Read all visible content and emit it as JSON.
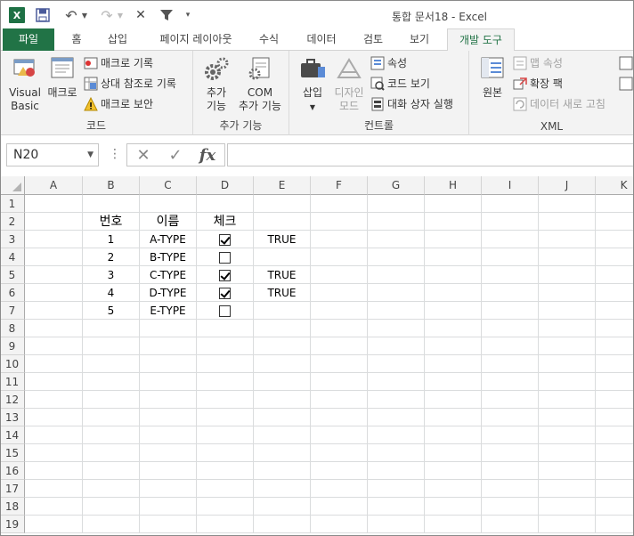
{
  "title": "통합 문서18 - Excel",
  "quick_access": {
    "app_icon": "excel-logo",
    "app_letter": "X",
    "icons": [
      "save-icon",
      "undo-icon",
      "redo-icon",
      "close-icon",
      "filter-icon",
      "customize-dropdown-icon"
    ]
  },
  "ribbon_tabs": [
    {
      "label": "파일"
    },
    {
      "label": "홈"
    },
    {
      "label": "삽입"
    },
    {
      "label": "페이지 레이아웃"
    },
    {
      "label": "수식"
    },
    {
      "label": "데이터"
    },
    {
      "label": "검토"
    },
    {
      "label": "보기"
    },
    {
      "label": "개발 도구"
    }
  ],
  "active_tab": "개발 도구",
  "ribbon": {
    "code": {
      "label": "코드",
      "visual_basic": "Visual Basic",
      "visual_basic_line1": "Visual",
      "visual_basic_line2": "Basic",
      "macro": "매크로",
      "record_macro": "매크로 기록",
      "relative_ref": "상대 참조로 기록",
      "macro_security": "매크로 보안"
    },
    "addins": {
      "label": "추가 기능",
      "addins_line1": "추가",
      "addins_line2": "기능",
      "com_line1": "COM",
      "com_line2": "추가 기능"
    },
    "controls": {
      "label": "컨트롤",
      "insert": "삽입",
      "design_line1": "디자인",
      "design_line2": "모드",
      "properties": "속성",
      "view_code": "코드 보기",
      "run_dialog": "대화 상자 실행"
    },
    "xml": {
      "label": "XML",
      "source": "원본",
      "map_properties": "맵 속성",
      "expansion_packs": "확장 팩",
      "refresh_data": "데이터 새로 고침"
    }
  },
  "formula_bar": {
    "name_box": "N20",
    "fx_label": "fx",
    "formula": ""
  },
  "columns": [
    "A",
    "B",
    "C",
    "D",
    "E",
    "F",
    "G",
    "H",
    "I",
    "J",
    "K"
  ],
  "rows": [
    "1",
    "2",
    "3",
    "4",
    "5",
    "6",
    "7",
    "8",
    "9",
    "10",
    "11",
    "12",
    "13",
    "14",
    "15",
    "16",
    "17",
    "18",
    "19"
  ],
  "table": {
    "headers": {
      "num": "번호",
      "name": "이름",
      "check": "체크"
    },
    "rows": [
      {
        "num": "1",
        "name": "A-TYPE",
        "checked": true,
        "value": "TRUE"
      },
      {
        "num": "2",
        "name": "B-TYPE",
        "checked": false,
        "value": ""
      },
      {
        "num": "3",
        "name": "C-TYPE",
        "checked": true,
        "value": "TRUE"
      },
      {
        "num": "4",
        "name": "D-TYPE",
        "checked": true,
        "value": "TRUE"
      },
      {
        "num": "5",
        "name": "E-TYPE",
        "checked": false,
        "value": ""
      }
    ]
  },
  "colors": {
    "excel_green": "#217346",
    "ribbon_bg": "#f3f3f3"
  }
}
